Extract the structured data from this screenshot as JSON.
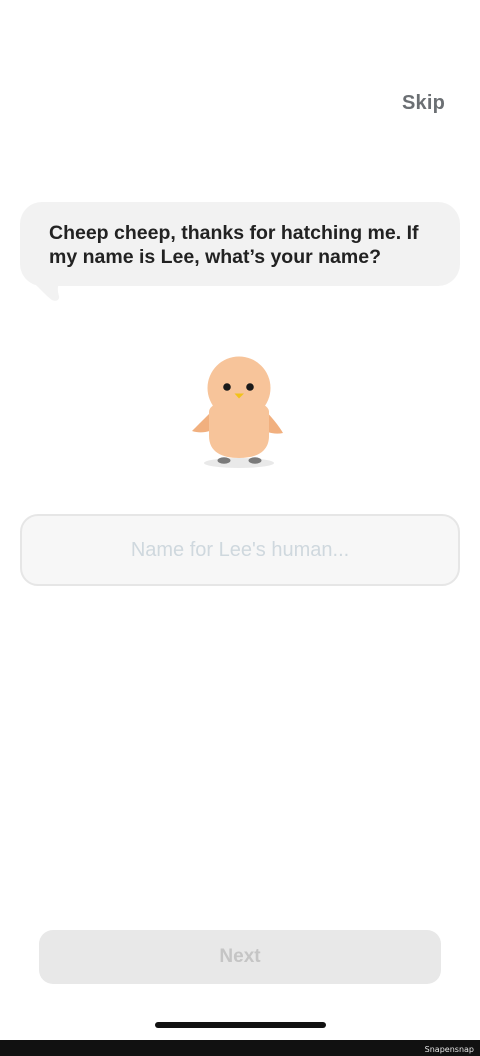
{
  "header": {
    "skip_label": "Skip"
  },
  "speech": {
    "text": "Cheep cheep, thanks for hatching me. If my name is Lee, what’s your name?"
  },
  "mascot": {
    "icon": "chick-mascot-icon",
    "body_color": "#f7c49a",
    "wing_color": "#f1b07f",
    "beak_color": "#f2c21a"
  },
  "name_input": {
    "value": "",
    "placeholder": "Name for Lee's human..."
  },
  "footer": {
    "next_label": "Next"
  },
  "watermark": {
    "text": "Snapensnap"
  }
}
